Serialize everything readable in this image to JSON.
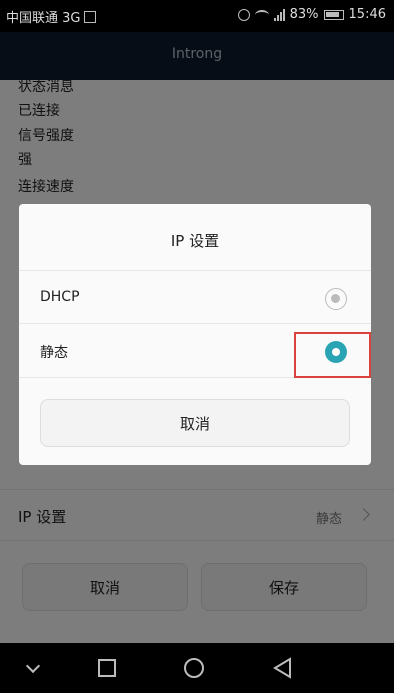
{
  "status_bar": {
    "carrier": "中国联通 3G",
    "battery_percent": "83%",
    "time": "15:46"
  },
  "header": {
    "title": "Introng"
  },
  "background_info": {
    "lines": [
      "状态消息",
      "已连接",
      "信号强度",
      "强",
      "连接速度"
    ]
  },
  "ip_settings_row": {
    "label": "IP 设置",
    "value": "静态"
  },
  "bottom_buttons": {
    "cancel": "取消",
    "save": "保存"
  },
  "dialog": {
    "title": "IP 设置",
    "options": [
      {
        "label": "DHCP",
        "selected": false
      },
      {
        "label": "静态",
        "selected": true
      }
    ],
    "cancel_label": "取消"
  },
  "colors": {
    "accent": "#2aa3b5",
    "highlight": "#d9433c",
    "header_bg": "#0c1b2d"
  },
  "icons": {
    "status": [
      "image-icon",
      "alarm-icon",
      "wifi-icon",
      "signal-icon",
      "battery-icon"
    ],
    "nav": [
      "back-icon",
      "recent-apps-icon",
      "home-icon",
      "back-triangle-icon"
    ]
  }
}
